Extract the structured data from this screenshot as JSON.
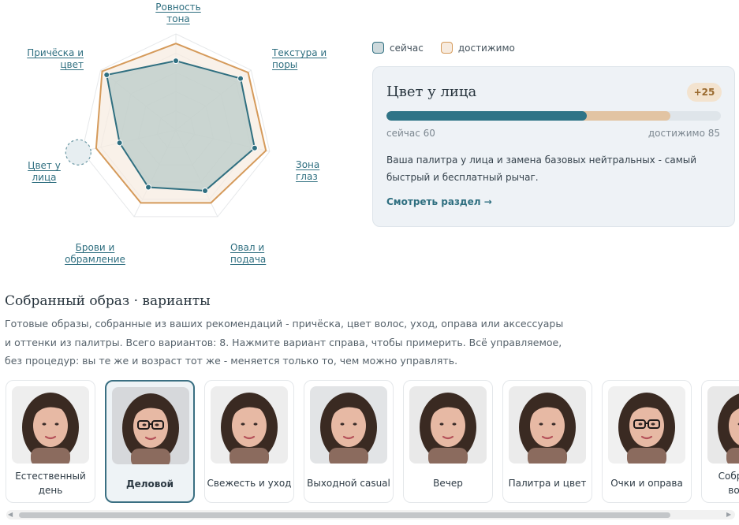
{
  "radar": {
    "axes": [
      {
        "id": "evenness",
        "label": "Ровность тона",
        "now": 0.72,
        "goal": 0.9
      },
      {
        "id": "texture",
        "label": "Текстура и поры",
        "now": 0.86,
        "goal": 0.96
      },
      {
        "id": "eyes",
        "label": "Зона глаз",
        "now": 0.84,
        "goal": 0.96
      },
      {
        "id": "oval",
        "label": "Овал и подача",
        "now": 0.7,
        "goal": 0.84
      },
      {
        "id": "brows",
        "label": "Брови и обрамление",
        "now": 0.66,
        "goal": 0.84
      },
      {
        "id": "face_color",
        "label": "Цвет у лица",
        "now": 0.6,
        "goal": 0.85
      },
      {
        "id": "hair",
        "label": "Причёска и цвет",
        "now": 0.92,
        "goal": 0.98
      }
    ],
    "selected_axis": "face_color"
  },
  "legend": {
    "now_label": "сейчас",
    "goal_label": "достижимо"
  },
  "card": {
    "title": "Цвет у лица",
    "delta": "+25",
    "now_value": 60,
    "goal_value": 85,
    "now_text": "сейчас 60",
    "goal_text": "достижимо 85",
    "description": "Ваша палитра у лица и замена базовых нейтральных - самый быстрый и бесплатный рычаг.",
    "link": "Смотреть раздел →"
  },
  "section": {
    "title": "Собранный образ · варианты",
    "description": "Готовые образы, собранные из ваших рекомендаций - причёска, цвет волос, уход, оправа или аксессуары и оттенки из палитры. Всего вариантов: 8. Нажмите вариант справа, чтобы примерить. Всё управляемое, без процедур: вы те же и возраст тот же - меняется только то, чем можно управлять."
  },
  "variants": [
    {
      "label": "Естественный день",
      "active": false,
      "glasses": false,
      "bg": "#eeeeee"
    },
    {
      "label": "Деловой",
      "active": true,
      "glasses": true,
      "bg": "#d6d8db"
    },
    {
      "label": "Свежесть и уход",
      "active": false,
      "glasses": false,
      "bg": "#ededed"
    },
    {
      "label": "Выходной casual",
      "active": false,
      "glasses": false,
      "bg": "#e2e4e6"
    },
    {
      "label": "Вечер",
      "active": false,
      "glasses": false,
      "bg": "#e9e9e9"
    },
    {
      "label": "Палитра и цвет",
      "active": false,
      "glasses": false,
      "bg": "#ebebeb"
    },
    {
      "label": "Очки и оправа",
      "active": false,
      "glasses": true,
      "bg": "#f0f0f0"
    },
    {
      "label": "Собранные волосы",
      "active": false,
      "glasses": false,
      "bg": "#e8e8e8"
    }
  ],
  "scrollbar": {
    "position": 0.0,
    "visible_fraction": 0.9
  },
  "colors": {
    "now": "#2f6f80",
    "goal": "#d59a5a",
    "accent": "#2f7487"
  }
}
